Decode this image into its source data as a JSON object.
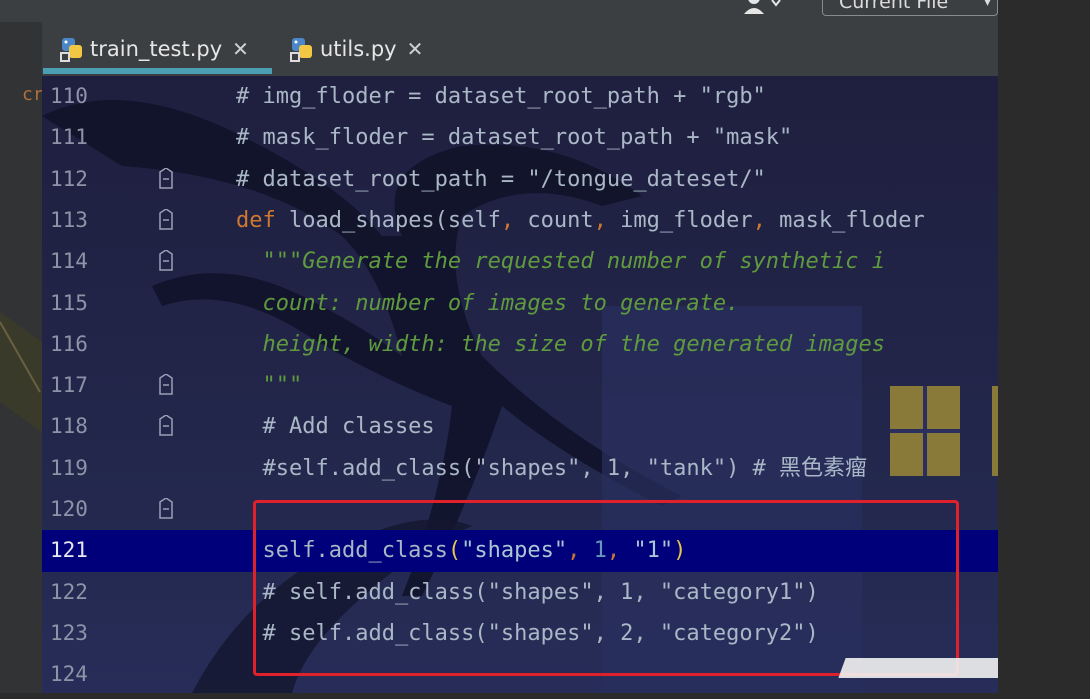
{
  "toolbar": {
    "run_config_label": "Current File",
    "user_icon": "user-icon"
  },
  "tabs": [
    {
      "label": "train_test.py",
      "icon": "python-file-icon",
      "close": "✕",
      "active": true
    },
    {
      "label": "utils.py",
      "icon": "python-file-icon",
      "close": "✕",
      "active": false
    }
  ],
  "left_gutter_fragment": "cr",
  "editor": {
    "current_line": 121,
    "lines": [
      {
        "num": "110",
        "parts": [
          {
            "t": "# img_floder = dataset_root_path + \"rgb\"",
            "c": "cmt"
          }
        ]
      },
      {
        "num": "111",
        "parts": [
          {
            "t": "# mask_floder = dataset_root_path + \"mask\"",
            "c": "cmt"
          }
        ]
      },
      {
        "num": "112",
        "parts": [
          {
            "t": "# dataset_root_path = \"/tongue_dateset/\"",
            "c": "cmt"
          }
        ]
      },
      {
        "num": "113",
        "parts": [
          {
            "t": "def ",
            "c": "kw"
          },
          {
            "t": "load_shapes(self",
            "c": ""
          },
          {
            "t": ",",
            "c": "punc"
          },
          {
            "t": " count",
            "c": ""
          },
          {
            "t": ",",
            "c": "punc"
          },
          {
            "t": " img_floder",
            "c": ""
          },
          {
            "t": ",",
            "c": "punc"
          },
          {
            "t": " mask_floder",
            "c": ""
          }
        ]
      },
      {
        "num": "114",
        "parts": [
          {
            "t": "  \"\"\"Generate the requested number of synthetic i",
            "c": "doc"
          }
        ]
      },
      {
        "num": "115",
        "parts": [
          {
            "t": "  count: number of images to generate.",
            "c": "doc"
          }
        ]
      },
      {
        "num": "116",
        "parts": [
          {
            "t": "  height, width: the size of the generated images",
            "c": "doc"
          }
        ]
      },
      {
        "num": "117",
        "parts": [
          {
            "t": "  \"\"\"",
            "c": "doc"
          }
        ]
      },
      {
        "num": "118",
        "parts": [
          {
            "t": "  # Add classes",
            "c": "cmt"
          }
        ]
      },
      {
        "num": "119",
        "parts": [
          {
            "t": "  #self.add_class(\"shapes\", 1, \"tank\") # 黑色素瘤",
            "c": "cmt"
          }
        ]
      },
      {
        "num": "120",
        "parts": [
          {
            "t": "",
            "c": ""
          }
        ]
      },
      {
        "num": "121",
        "parts": [
          {
            "t": "  self.add_class",
            "c": ""
          },
          {
            "t": "(",
            "c": "paren-hl"
          },
          {
            "t": "\"shapes\"",
            "c": "str"
          },
          {
            "t": ",",
            "c": "punc"
          },
          {
            "t": " 1",
            "c": "num"
          },
          {
            "t": ",",
            "c": "punc"
          },
          {
            "t": " \"1\"",
            "c": "str"
          },
          {
            "t": ")",
            "c": "paren-hl"
          }
        ]
      },
      {
        "num": "122",
        "parts": [
          {
            "t": "  # self.add_class(\"shapes\", 1, \"category1\")",
            "c": "cmt"
          }
        ]
      },
      {
        "num": "123",
        "parts": [
          {
            "t": "  # self.add_class(\"shapes\", 2, \"category2\")",
            "c": "cmt"
          }
        ]
      },
      {
        "num": "124",
        "parts": [
          {
            "t": "",
            "c": ""
          }
        ]
      }
    ],
    "fold_markers": [
      "112",
      "113",
      "114",
      "117",
      "118",
      "120"
    ]
  },
  "colors": {
    "keyword": "#cc7832",
    "docstring": "#5f9b3e",
    "current_line_bg": "#00007a",
    "highlight_box": "#e0202a",
    "active_tab_underline": "#4a9fb4"
  }
}
